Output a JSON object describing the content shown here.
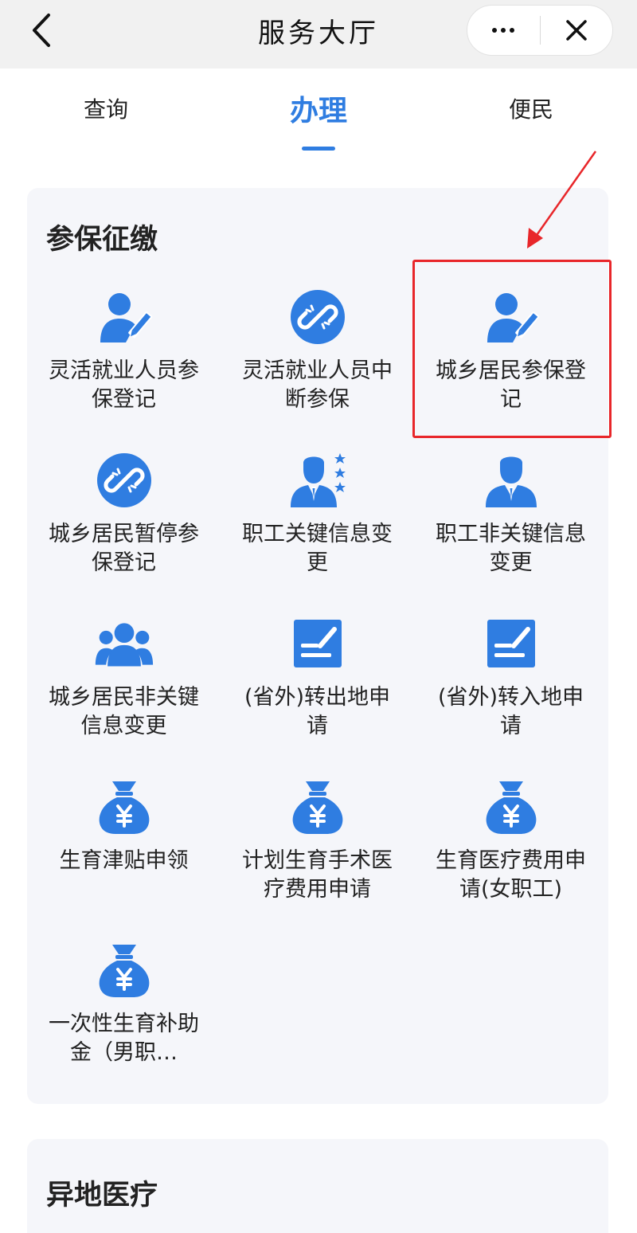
{
  "header": {
    "title": "服务大厅"
  },
  "tabs": [
    {
      "label": "查询"
    },
    {
      "label": "办理"
    },
    {
      "label": "便民"
    }
  ],
  "sections": [
    {
      "title": "参保征缴",
      "items": [
        {
          "label": "灵活就业人员参保登记",
          "icon": "person-edit-icon"
        },
        {
          "label": "灵活就业人员中断参保",
          "icon": "broken-link-icon"
        },
        {
          "label": "城乡居民参保登记",
          "icon": "person-edit-icon"
        },
        {
          "label": "城乡居民暂停参保登记",
          "icon": "broken-link-icon"
        },
        {
          "label": "职工关键信息变更",
          "icon": "staff-star-icon"
        },
        {
          "label": "职工非关键信息变更",
          "icon": "staff-icon"
        },
        {
          "label": "城乡居民非关键信息变更",
          "icon": "group-icon"
        },
        {
          "label": "(省外)转出地申请",
          "icon": "sign-form-icon"
        },
        {
          "label": "(省外)转入地申请",
          "icon": "sign-form-icon"
        },
        {
          "label": "生育津贴申领",
          "icon": "money-bag-icon"
        },
        {
          "label": "计划生育手术医疗费用申请",
          "icon": "money-bag-icon"
        },
        {
          "label": "生育医疗费用申请(女职工)",
          "icon": "money-bag-icon"
        },
        {
          "label": "一次性生育补助金（男职…",
          "icon": "money-bag-icon"
        }
      ]
    },
    {
      "title": "异地医疗"
    }
  ],
  "colors": {
    "accent": "#2f7de1",
    "icon_blue": "#2f7de1",
    "highlight": "#e8262a"
  }
}
